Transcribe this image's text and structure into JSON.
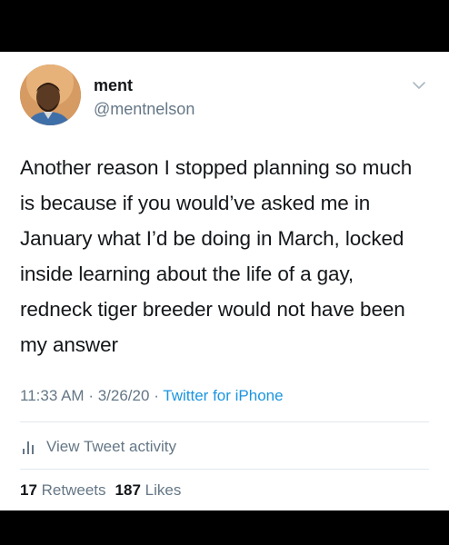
{
  "tweet": {
    "display_name": "ment",
    "handle": "@mentnelson",
    "text": "Another reason I stopped planning so much is because if you would’ve asked me in January what I’d be doing in March, locked inside learning about the life of a gay, redneck tiger breeder would not have been my answer",
    "time": "11:33 AM",
    "date": "3/26/20",
    "separator": "·",
    "source": "Twitter for iPhone",
    "activity_label": "View Tweet activity",
    "retweets_count": "17",
    "retweets_label": "Retweets",
    "likes_count": "187",
    "likes_label": "Likes"
  },
  "icons": {
    "more": "chevron-down-icon",
    "activity": "bar-chart-icon",
    "avatar": "avatar"
  },
  "colors": {
    "background": "#ffffff",
    "text": "#14171a",
    "secondary": "#657786",
    "link": "#1b95e0",
    "divider": "#e1e8ed",
    "letterbox": "#000000"
  }
}
